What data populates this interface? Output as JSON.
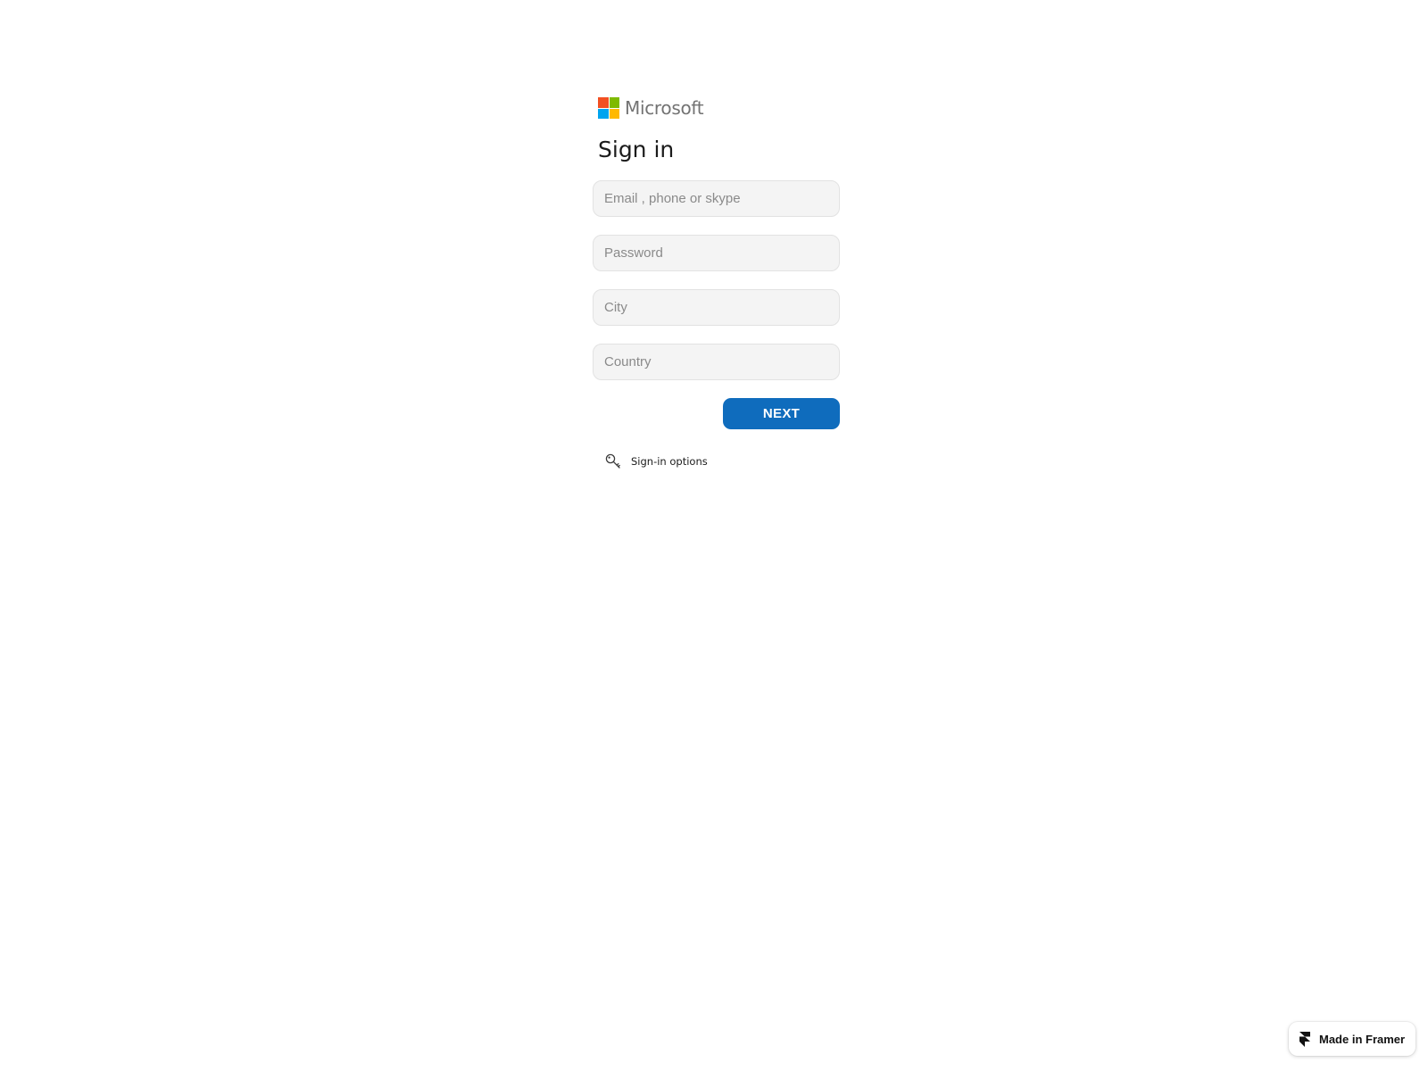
{
  "brand": {
    "name": "Microsoft",
    "colors": {
      "red": "#f25022",
      "green": "#7fba00",
      "blue": "#00a4ef",
      "yellow": "#ffb900"
    }
  },
  "form": {
    "title": "Sign in",
    "fields": [
      {
        "placeholder": "Email , phone or skype",
        "value": ""
      },
      {
        "placeholder": "Password",
        "value": ""
      },
      {
        "placeholder": "City",
        "value": ""
      },
      {
        "placeholder": "Country",
        "value": ""
      }
    ],
    "next_label": "NEXT",
    "accent_color": "#0f6cbd"
  },
  "options": {
    "icon": "key-icon",
    "label": "Sign-in options"
  },
  "badge": {
    "icon": "framer-logo-icon",
    "label": "Made in Framer"
  }
}
